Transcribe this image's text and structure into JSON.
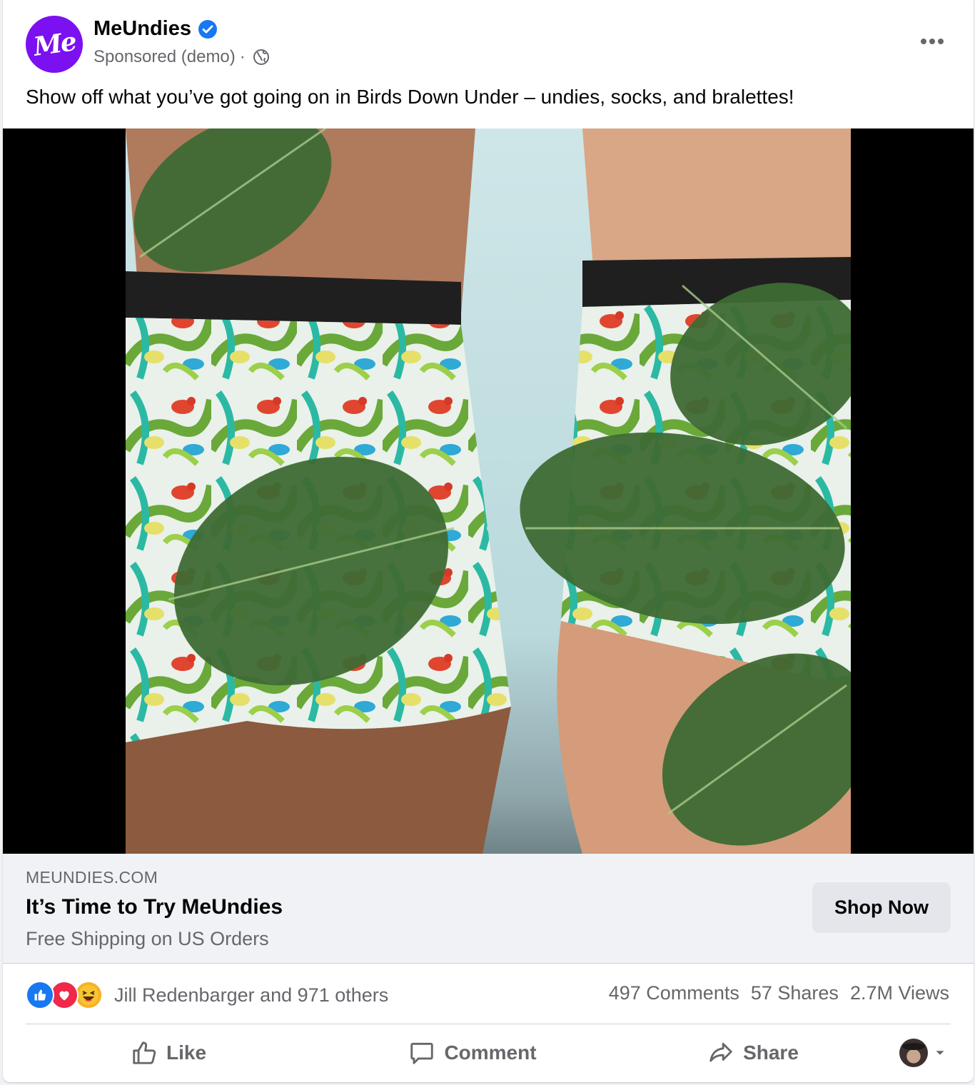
{
  "post": {
    "page_name": "MeUndies",
    "avatar_text": "Me",
    "sponsored_label": "Sponsored (demo)",
    "separator": "·",
    "caption": "Show off what you’ve got going on in Birds Down Under – undies, socks, and bralettes!"
  },
  "link": {
    "domain": "MEUNDIES.COM",
    "headline": "It’s Time to Try MeUndies",
    "description": "Free Shipping on US Orders",
    "cta_label": "Shop Now"
  },
  "stats": {
    "reactors": "Jill Redenbarger and 971 others",
    "comments": "497 Comments",
    "shares": "57 Shares",
    "views": "2.7M Views"
  },
  "actions": {
    "like": "Like",
    "comment": "Comment",
    "share": "Share"
  },
  "colors": {
    "brand_purple": "#7b10f0",
    "facebook_blue": "#1877f2",
    "secondary_text": "#65676b"
  },
  "icons": [
    "verified-badge-icon",
    "globe-icon",
    "more-options-icon",
    "mute-icon",
    "like-reaction-icon",
    "love-reaction-icon",
    "haha-reaction-icon",
    "thumbs-up-icon",
    "comment-icon",
    "share-icon",
    "chevron-down-icon"
  ]
}
